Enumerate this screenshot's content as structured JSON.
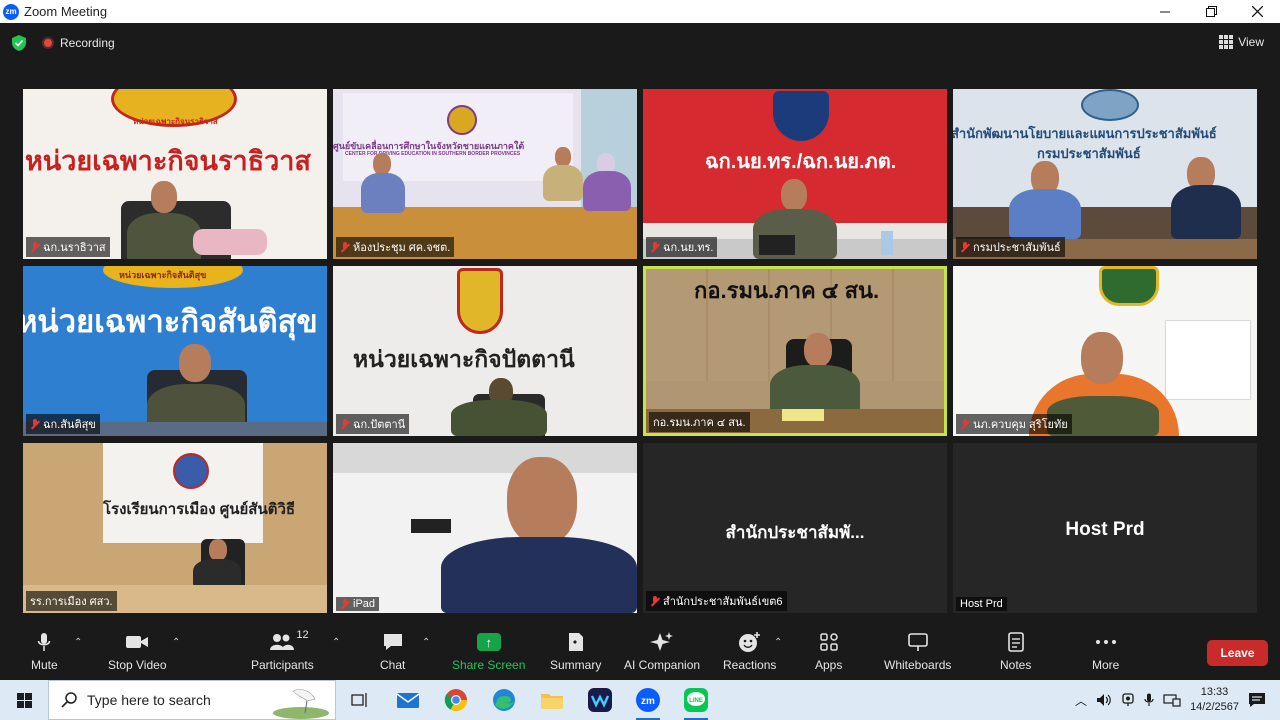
{
  "window": {
    "title": "Zoom Meeting",
    "app_logo_text": "zm",
    "controls": [
      "minimize",
      "maximize",
      "close"
    ]
  },
  "meeting": {
    "recording_label": "Recording",
    "view_label": "View"
  },
  "tiles": [
    {
      "name": "ฉก.นราธิวาส",
      "sign": "หน่วยเฉพาะกิจนราธิวาส",
      "small_sign": "หน่วยเฉพาะกิจนราธิวาส",
      "muted": true
    },
    {
      "name": "ห้องประชุม ศค.จชต.",
      "sign": "ศูนย์ขับเคลื่อนการศึกษาในจังหวัดชายแดนภาคใต้",
      "small_sign": "CENTER FOR DRIVING EDUCATION IN SOUTHERN BORDER PROVINCES",
      "muted": true
    },
    {
      "name": "ฉก.นย.ทร.",
      "sign": "ฉก.นย.ทร./ฉก.นย.ภต.",
      "muted": true
    },
    {
      "name": "กรมประชาสัมพันธ์",
      "sign": "สำนักพัฒนานโยบายและแผนการประชาสัมพันธ์",
      "sub_sign": "กรมประชาสัมพันธ์",
      "muted": true
    },
    {
      "name": "ฉก.สันติสุข",
      "sign": "หน่วยเฉพาะกิจสันติสุข",
      "small_sign": "หน่วยเฉพาะกิจสันติสุข",
      "muted": true
    },
    {
      "name": "ฉก.ปัตตานี",
      "sign": "หน่วยเฉพาะกิจปัตตานี",
      "muted": true
    },
    {
      "name": "กอ.รมน.ภาค ๔ สน.",
      "sign": "กอ.รมน.ภาค ๔ สน.",
      "muted": false,
      "active_speaker": true
    },
    {
      "name": "นภ.ควบคุม สุริโยทัย",
      "muted": true
    },
    {
      "name": "รร.การเมือง ศสว.",
      "sign": "โรงเรียนการเมือง ศูนย์สันติวิธี",
      "muted": false
    },
    {
      "name": "iPad",
      "muted": true
    },
    {
      "name": "สำนักประชาสัมพันธ์เขต6",
      "display_name": "สำนักประชาสัมพั...",
      "muted": true,
      "video_off": true
    },
    {
      "name": "Host Prd",
      "display_name": "Host Prd",
      "muted": false,
      "video_off": true
    }
  ],
  "toolbar": {
    "mute": "Mute",
    "stop_video": "Stop Video",
    "participants": "Participants",
    "participants_count": "12",
    "chat": "Chat",
    "share_screen": "Share Screen",
    "summary": "Summary",
    "ai_companion": "AI Companion",
    "reactions": "Reactions",
    "apps": "Apps",
    "whiteboards": "Whiteboards",
    "notes": "Notes",
    "more": "More",
    "leave": "Leave"
  },
  "taskbar": {
    "search_placeholder": "Type here to search",
    "time": "13:33",
    "date": "14/2/2567"
  },
  "colors": {
    "accent_share": "#16a34a",
    "leave_red": "#c92b2b",
    "active_speaker_border": "#c6e34a",
    "zoom_blue": "#0b5cff"
  }
}
